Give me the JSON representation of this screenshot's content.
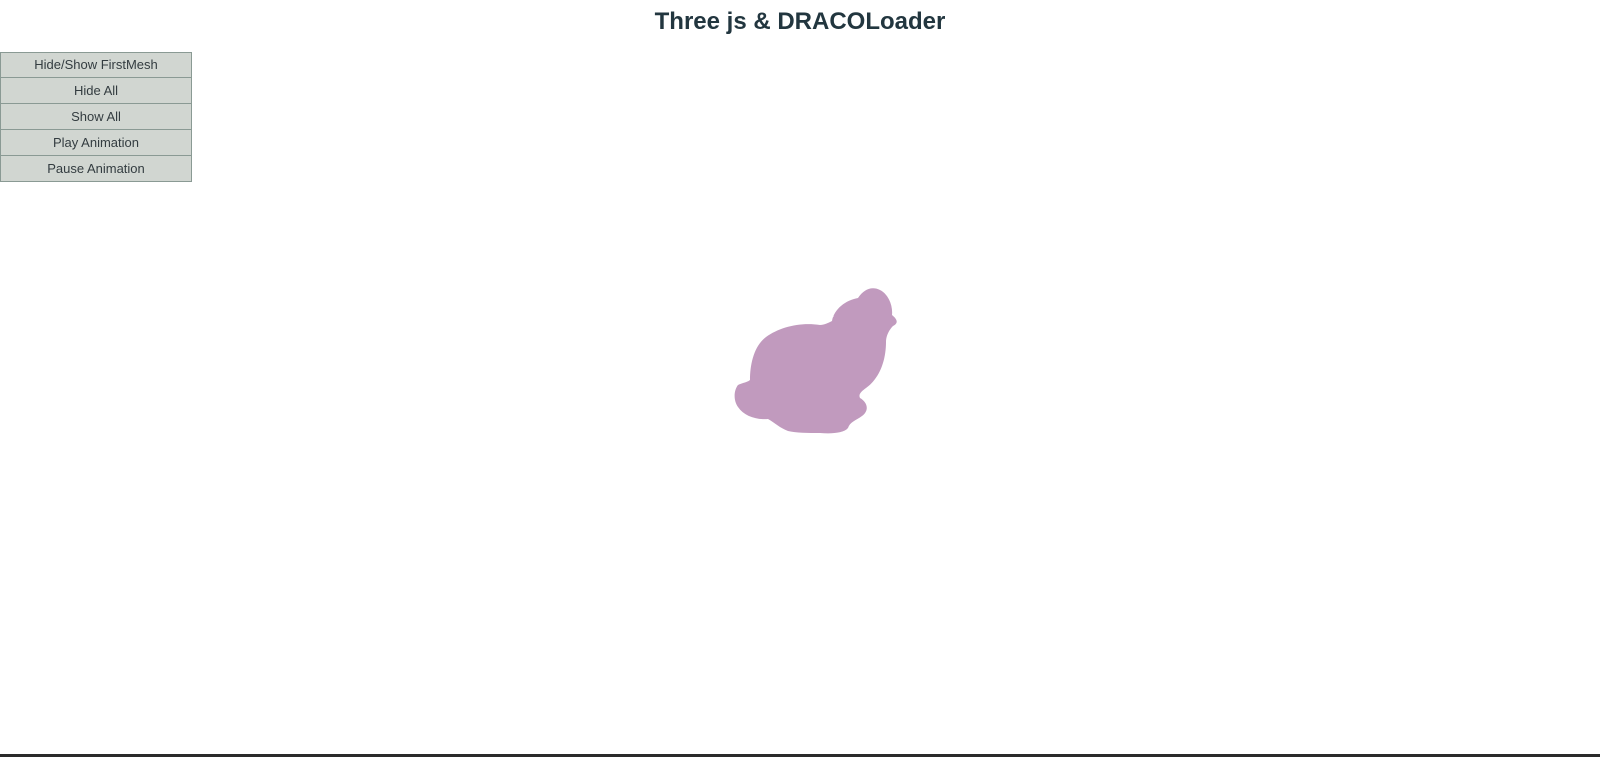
{
  "page": {
    "title": "Three js & DRACOLoader"
  },
  "controls": {
    "buttons": [
      {
        "label": "Hide/Show FirstMesh"
      },
      {
        "label": "Hide All"
      },
      {
        "label": "Show All"
      },
      {
        "label": "Play Animation"
      },
      {
        "label": "Pause Animation"
      }
    ]
  },
  "scene": {
    "model_color": "#c19abe",
    "background_color": "#ffffff"
  }
}
